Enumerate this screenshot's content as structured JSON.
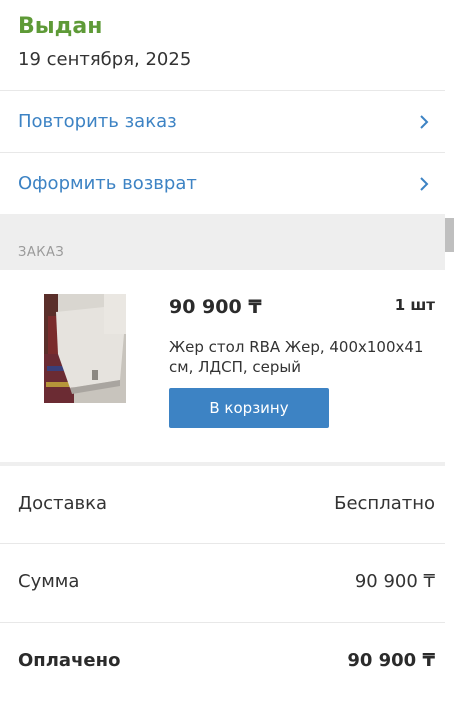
{
  "order": {
    "status": "Выдан",
    "date": "19 сентября, 2025"
  },
  "actions": [
    {
      "label": "Повторить заказ",
      "icon": "chevron-right-icon"
    },
    {
      "label": "Оформить возврат",
      "icon": "chevron-right-icon"
    }
  ],
  "section": {
    "label": "ЗАКАЗ"
  },
  "item": {
    "price": "90 900 ₸",
    "quantity": "1 шт",
    "name": "Жер стол RBA Жер, 400x100x41 см, ЛДСП, серый",
    "cart_button": "В корзину"
  },
  "summary": [
    {
      "label": "Доставка",
      "value": "Бесплатно"
    },
    {
      "label": "Сумма",
      "value": "90 900 ₸"
    },
    {
      "label": "Оплачено",
      "value": "90 900 ₸"
    }
  ],
  "colors": {
    "status_green": "#5e9a37",
    "link_blue": "#3d83c4",
    "section_bg": "#eeeeee"
  }
}
